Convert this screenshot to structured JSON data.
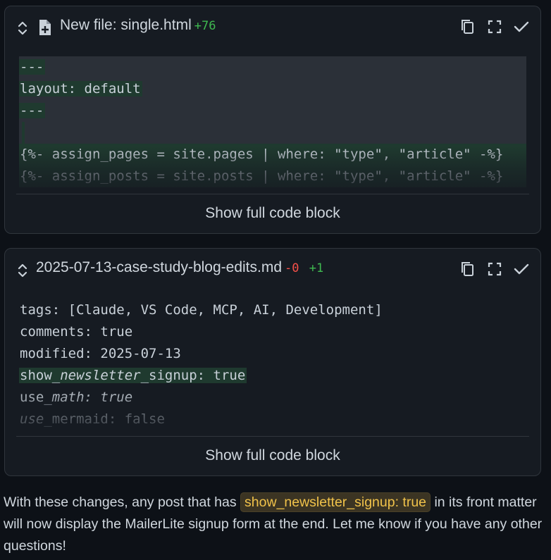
{
  "card1": {
    "title": "New file: single.html",
    "added": "+76",
    "lines": [
      "---",
      "layout: default",
      "---",
      "",
      "{%- assign_pages = site.pages | where: \"type\", \"article\" -%}",
      "{%- assign_posts = site.posts | where: \"type\", \"article\" -%}"
    ],
    "show_label": "Show full code block"
  },
  "card2": {
    "title": "2025-07-13-case-study-blog-edits.md",
    "removed": "-0",
    "added": "+1",
    "lines": {
      "l1": "tags: [Claude, VS Code, MCP, AI, Development]",
      "l2": "comments: true",
      "l3": "modified: 2025-07-13",
      "l4a": "show_",
      "l4b": "newsletter",
      "l4c": "_signup: true",
      "l5a": "use_",
      "l5b": "math: true",
      "l6a": "use",
      "l6b": "_mermaid: false"
    },
    "show_label": "Show full code block"
  },
  "message": {
    "before": "With these changes, any post that has ",
    "code": "show_newsletter_signup: true",
    "after": " in its front matter will now display the MailerLite signup form at the end. Let me know if you have any other questions!"
  },
  "icons": [
    "chevron-up-down-icon",
    "new-file-icon",
    "copy-icon",
    "expand-icon",
    "check-icon"
  ],
  "colors": {
    "added": "#3fb950",
    "removed": "#f85149",
    "highlight": "#1f3a2f",
    "inline_code": "#f0c24a"
  }
}
